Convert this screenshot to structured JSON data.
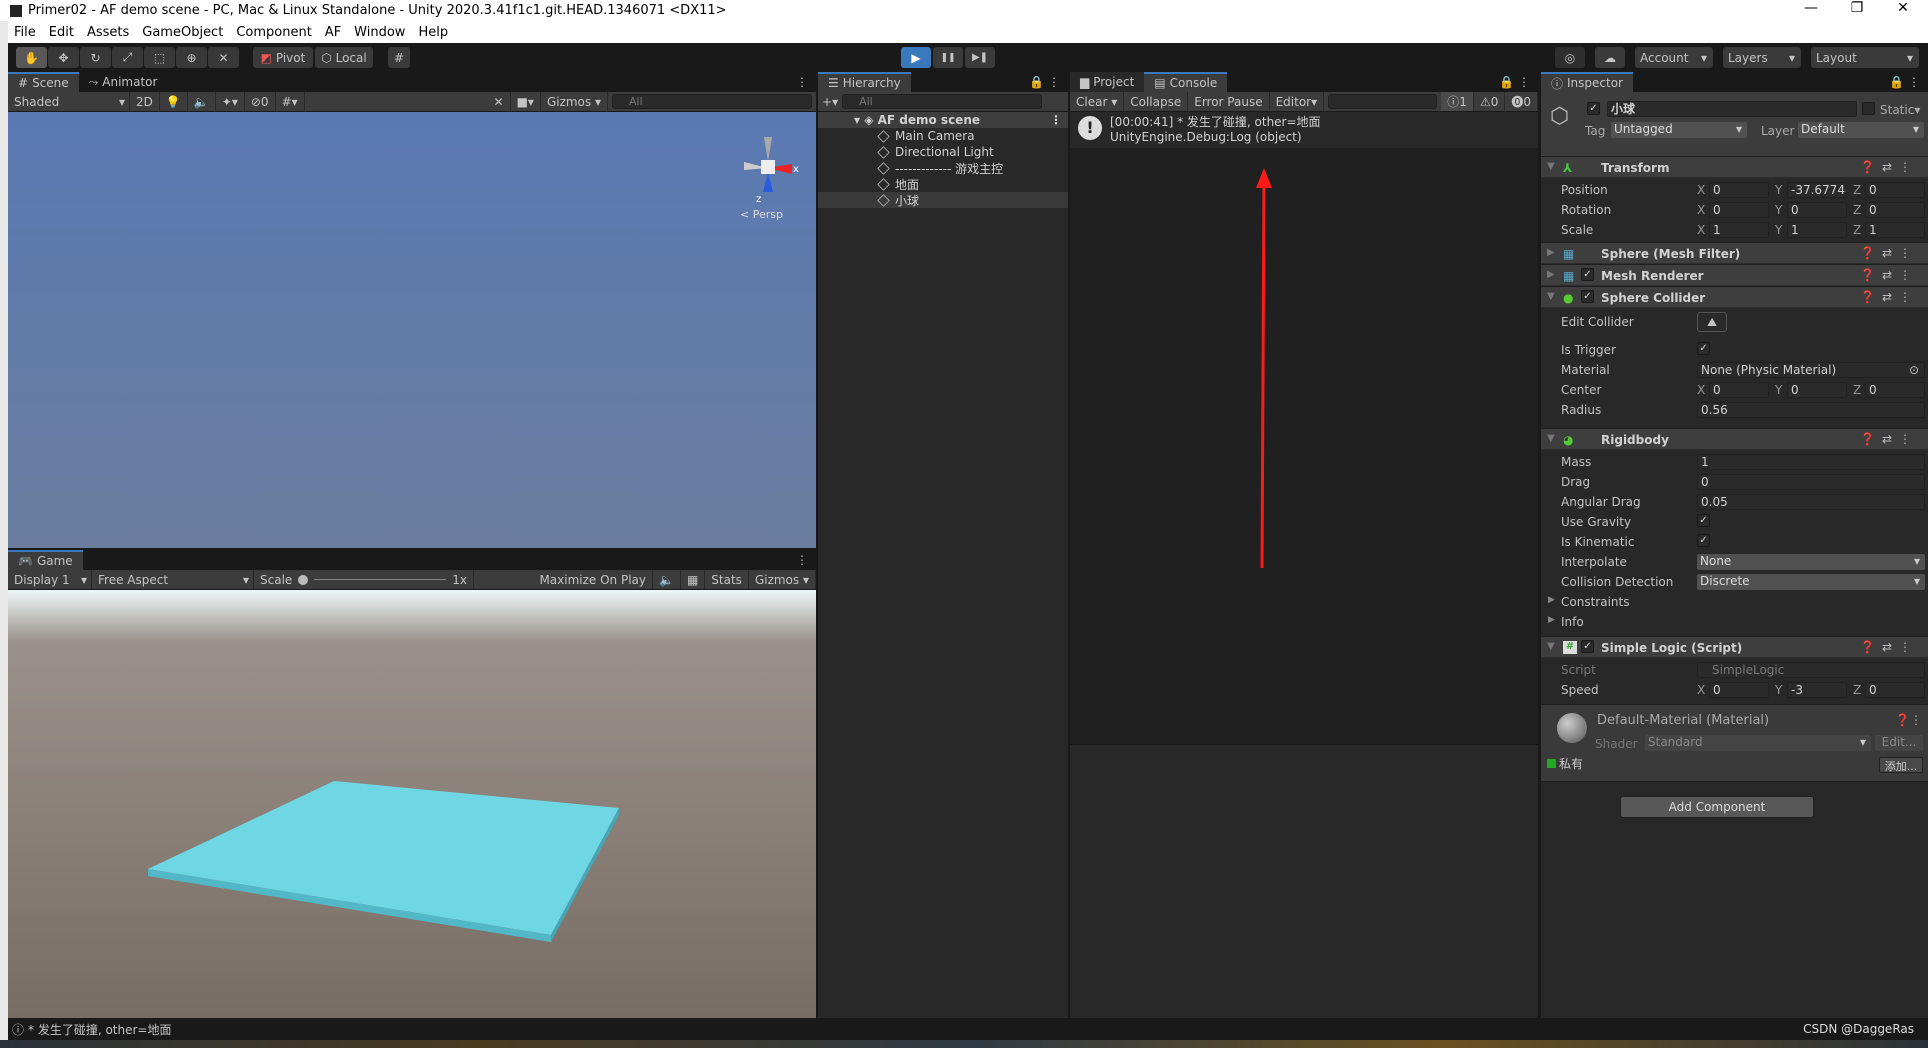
{
  "window": {
    "title": "Primer02 - AF demo scene - PC, Mac & Linux Standalone - Unity 2020.3.41f1c1.git.HEAD.1346071 <DX11>",
    "minimize": "—",
    "maximize": "❐",
    "close": "✕"
  },
  "menu": [
    "File",
    "Edit",
    "Assets",
    "GameObject",
    "Component",
    "AF",
    "Window",
    "Help"
  ],
  "toolbar": {
    "tools": [
      "hand-tool",
      "move-tool",
      "rotate-tool",
      "scale-tool",
      "rect-tool",
      "transform-tool",
      "custom-tool"
    ],
    "pivot": "Pivot",
    "local": "Local",
    "play": "▶",
    "pause": "❚❚",
    "step": "▶❚",
    "account": "Account",
    "layers": "Layers",
    "layout": "Layout"
  },
  "scene": {
    "tabs": [
      "Scene",
      "Animator"
    ],
    "shading": "Shaded",
    "mode2d": "2D",
    "hidden_count": "0",
    "gizmos": "Gizmos",
    "search_placeholder": "All",
    "persp": "< Persp",
    "axis_x": "x",
    "axis_z": "z",
    "sky_color": "#5b79b0"
  },
  "game": {
    "tab": "Game",
    "display": "Display 1",
    "aspect": "Free Aspect",
    "scale_label": "Scale",
    "scale_value": "1x",
    "maximize": "Maximize On Play",
    "stats": "Stats",
    "gizmos": "Gizmos",
    "plane_color": "#6fd6e4",
    "ground_color": "#7b6f66"
  },
  "hierarchy": {
    "tab": "Hierarchy",
    "add": "+",
    "search_placeholder": "All",
    "scene": "AF demo scene",
    "items": [
      "Main Camera",
      "Directional Light",
      "------------- 游戏主控",
      "地面",
      "小球"
    ],
    "selected": 4
  },
  "console": {
    "tabs": [
      "Project",
      "Console"
    ],
    "clear": "Clear",
    "collapse": "Collapse",
    "error_pause": "Error Pause",
    "editor": "Editor",
    "count_log": "1",
    "count_warn": "0",
    "count_err": "0",
    "entry_line1": "[00:00:41] * 发生了碰撞, other=地面",
    "entry_line2": "UnityEngine.Debug:Log (object)",
    "arrow_color": "#ff1a1a"
  },
  "inspector": {
    "tab": "Inspector",
    "name": "小球",
    "static": "Static",
    "tag_label": "Tag",
    "tag": "Untagged",
    "layer_label": "Layer",
    "layer": "Default",
    "transform": {
      "title": "Transform",
      "position": [
        "0",
        "-37.67748",
        "0"
      ],
      "rotation": [
        "0",
        "0",
        "0"
      ],
      "scale": [
        "1",
        "1",
        "1"
      ],
      "labels": [
        "Position",
        "Rotation",
        "Scale"
      ]
    },
    "mesh_filter": "Sphere (Mesh Filter)",
    "mesh_renderer": "Mesh Renderer",
    "sphere_collider": {
      "title": "Sphere Collider",
      "edit_collider": "Edit Collider",
      "is_trigger": "Is Trigger",
      "material_label": "Material",
      "material": "None (Physic Material)",
      "center_label": "Center",
      "center": [
        "0",
        "0",
        "0"
      ],
      "radius_label": "Radius",
      "radius": "0.56"
    },
    "rigidbody": {
      "title": "Rigidbody",
      "mass_label": "Mass",
      "mass": "1",
      "drag_label": "Drag",
      "drag": "0",
      "angular_drag_label": "Angular Drag",
      "angular_drag": "0.05",
      "use_gravity": "Use Gravity",
      "is_kinematic": "Is Kinematic",
      "interpolate_label": "Interpolate",
      "interpolate": "None",
      "collision_label": "Collision Detection",
      "collision": "Discrete",
      "constraints": "Constraints",
      "info": "Info"
    },
    "script": {
      "title": "Simple Logic (Script)",
      "script_label": "Script",
      "script": "SimpleLogic",
      "speed_label": "Speed",
      "speed": [
        "0",
        "-3",
        "0"
      ]
    },
    "material": {
      "title": "Default-Material (Material)",
      "shader_label": "Shader",
      "shader": "Standard",
      "edit": "Edit...",
      "private": "私有",
      "add": "添加..."
    },
    "add_component": "Add Component",
    "axes": [
      "X",
      "Y",
      "Z"
    ]
  },
  "status": {
    "message": "* 发生了碰撞, other=地面",
    "watermark": "CSDN @DaggeRas"
  }
}
